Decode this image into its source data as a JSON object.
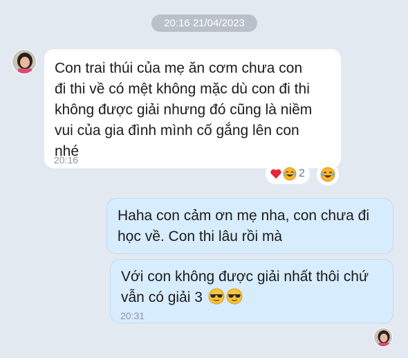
{
  "header": {
    "timestamp": "20:16 21/04/2023"
  },
  "messages": [
    {
      "direction": "incoming",
      "text": "Con trai thúi của mẹ ăn cơm chưa con đi thi về có mệt không mặc dù con đi thi không được giải nhưng đó cũng là niềm vui của gia đình mình cố gắng lên con nhé",
      "lines": [
        "Con trai thúi của mẹ ăn cơm chưa con",
        "đi thi về có mệt không mặc dù con đi thi",
        "không được giải nhưng đó cũng là niềm",
        "vui của gia đình mình cố gắng lên con",
        "nhé"
      ],
      "time": "20:16",
      "reactions": {
        "icons": [
          "heart-icon",
          "laughing-tears-emoji-icon"
        ],
        "count": "2"
      }
    },
    {
      "direction": "outgoing",
      "lines": [
        "Haha con cảm ơn mẹ nha, con chưa đi",
        "học về. Con thi lâu rồi mà"
      ]
    },
    {
      "direction": "outgoing",
      "lines": [
        "Với con không được giải nhất thôi chứ",
        "vẫn có giải 3"
      ],
      "emoji": [
        "sunglasses-emoji-icon",
        "sunglasses-emoji-icon"
      ],
      "time": "20:31"
    }
  ],
  "colors": {
    "background": "#e3e9f1",
    "incoming_bubble": "#ffffff",
    "outgoing_bubble": "#d7ecfd",
    "timestamp_pill": "#b9c0c9",
    "time_text": "#8e959e"
  }
}
